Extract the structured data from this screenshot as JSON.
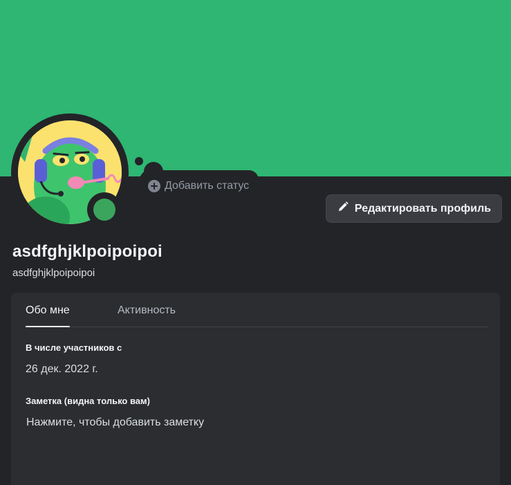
{
  "colors": {
    "banner": "#2eb672",
    "background": "#232428",
    "panel": "#2b2d31",
    "online": "#3ba55d"
  },
  "status": {
    "icon": "plus-circle-icon",
    "label": "Добавить статус"
  },
  "actions": {
    "edit_profile_icon": "pencil-icon",
    "edit_profile_label": "Редактировать профиль"
  },
  "profile": {
    "display_name": "asdfghjklpoipoipoi",
    "username": "asdfghjklpoipoipoi",
    "presence": "online"
  },
  "tabs": [
    {
      "label": "Обо мне",
      "active": true
    },
    {
      "label": "Активность",
      "active": false
    }
  ],
  "about": {
    "member_since_label": "В числе участников с",
    "member_since_value": "26 дек. 2022 г.",
    "note_label": "Заметка (видна только вам)",
    "note_placeholder": "Нажмите, чтобы добавить заметку"
  }
}
